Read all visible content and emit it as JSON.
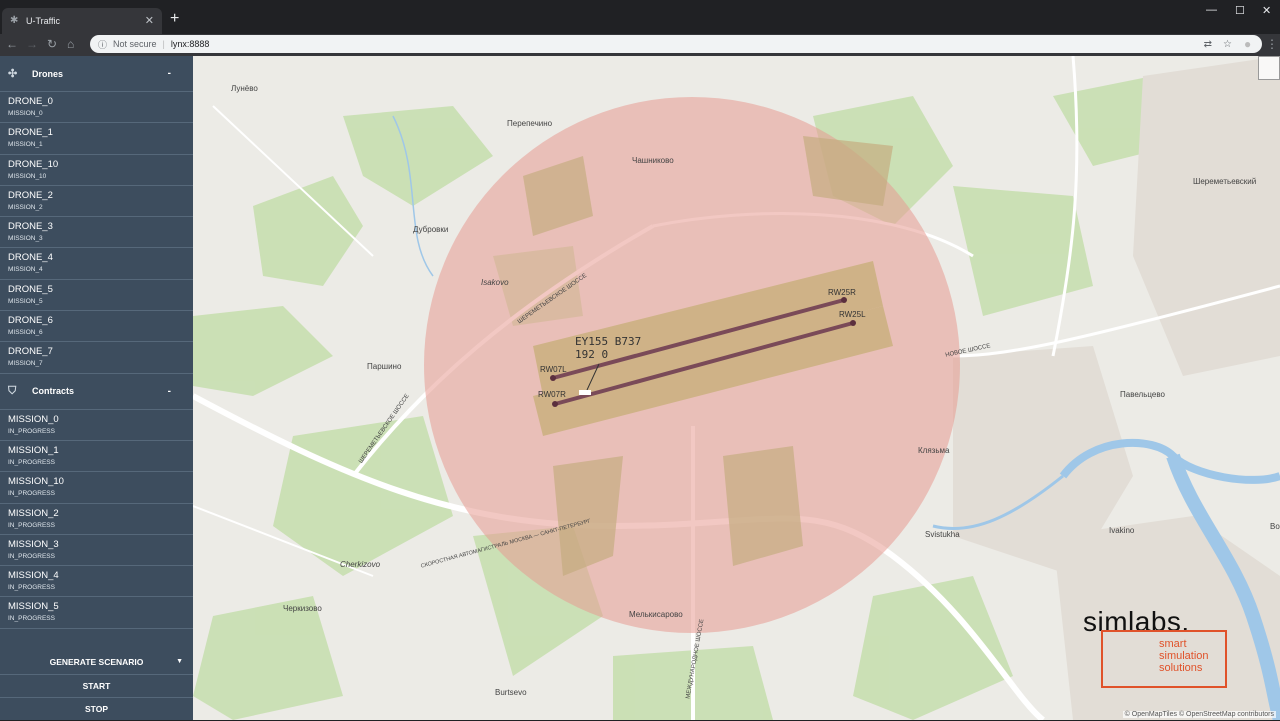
{
  "browser": {
    "tab_title": "U-Traffic",
    "not_secure": "Not secure",
    "url": "lynx:8888"
  },
  "sidebar": {
    "drones_title": "Drones",
    "drones": [
      {
        "name": "DRONE_0",
        "mission": "MISSION_0"
      },
      {
        "name": "DRONE_1",
        "mission": "MISSION_1"
      },
      {
        "name": "DRONE_10",
        "mission": "MISSION_10"
      },
      {
        "name": "DRONE_2",
        "mission": "MISSION_2"
      },
      {
        "name": "DRONE_3",
        "mission": "MISSION_3"
      },
      {
        "name": "DRONE_4",
        "mission": "MISSION_4"
      },
      {
        "name": "DRONE_5",
        "mission": "MISSION_5"
      },
      {
        "name": "DRONE_6",
        "mission": "MISSION_6"
      },
      {
        "name": "DRONE_7",
        "mission": "MISSION_7"
      }
    ],
    "contracts_title": "Contracts",
    "contracts": [
      {
        "name": "MISSION_0",
        "status": "IN_PROGRESS"
      },
      {
        "name": "MISSION_1",
        "status": "IN_PROGRESS"
      },
      {
        "name": "MISSION_10",
        "status": "IN_PROGRESS"
      },
      {
        "name": "MISSION_2",
        "status": "IN_PROGRESS"
      },
      {
        "name": "MISSION_3",
        "status": "IN_PROGRESS"
      },
      {
        "name": "MISSION_4",
        "status": "IN_PROGRESS"
      },
      {
        "name": "MISSION_5",
        "status": "IN_PROGRESS"
      }
    ],
    "generate": "GENERATE SCENARIO",
    "start": "START",
    "stop": "STOP"
  },
  "map": {
    "aircraft_line1": "EY155 B737",
    "aircraft_line2": "192 0",
    "runways": [
      "RW25R",
      "RW25L",
      "RW07L",
      "RW07R"
    ],
    "places": [
      "Лунёво",
      "Перепечино",
      "Чашниково",
      "Шереметьевский",
      "Дубровки",
      "Isakovo",
      "Паршино",
      "Павельцево",
      "Клязьма",
      "Ivakino",
      "Svistukha",
      "Cherkizovo",
      "Черкизово",
      "Мелькисарово",
      "Burtsevo",
      "Во"
    ],
    "roads": [
      "ШЕРЕМЕТЬЕВСКОЕ ШОССЕ",
      "ШЕРЕМЕТЬЕВСКОЕ ШОССЕ",
      "НОВОЕ ШОССЕ",
      "СКОРОСТНАЯ АВТОМАГИСТРАЛЬ МОСКВА — САНКТ-ПЕТЕРБУРГ",
      "МЕЖДУНАРОДНОЕ ШОССЕ"
    ],
    "attribution": "© OpenMapTiles © OpenStreetMap contributors",
    "zone_color": "#e89a92"
  },
  "logo": {
    "word": "simlabs.",
    "tag": [
      "smart",
      "simulation",
      "solutions"
    ],
    "accent": "#e0522a"
  }
}
